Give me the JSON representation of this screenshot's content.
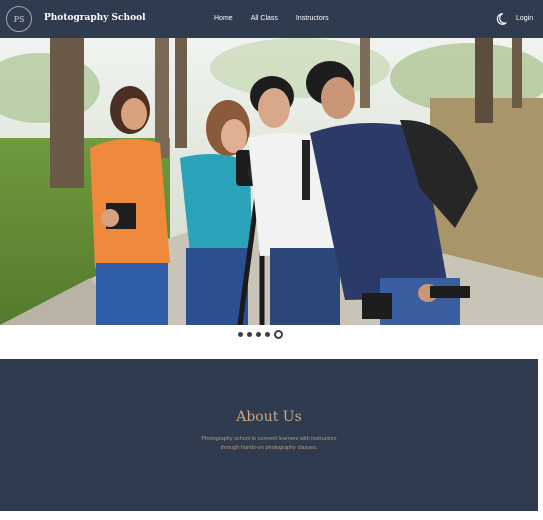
{
  "header": {
    "logo_text": "PS",
    "brand": "Photography School",
    "nav": [
      "Home",
      "All Class",
      "Instructors"
    ],
    "login_label": "Login",
    "theme_icon": "moon-icon",
    "colors": {
      "background": "#2f3b4f",
      "text": "#ffffff"
    }
  },
  "hero": {
    "image_description_icon": "hero-photo",
    "slides_count": 5,
    "active_slide": 5
  },
  "about": {
    "title": "About Us",
    "text": "Photography school to connect learners with instructors through hands-on photography classes.",
    "colors": {
      "background": "#2f3b4f",
      "title": "#c9a686"
    }
  }
}
